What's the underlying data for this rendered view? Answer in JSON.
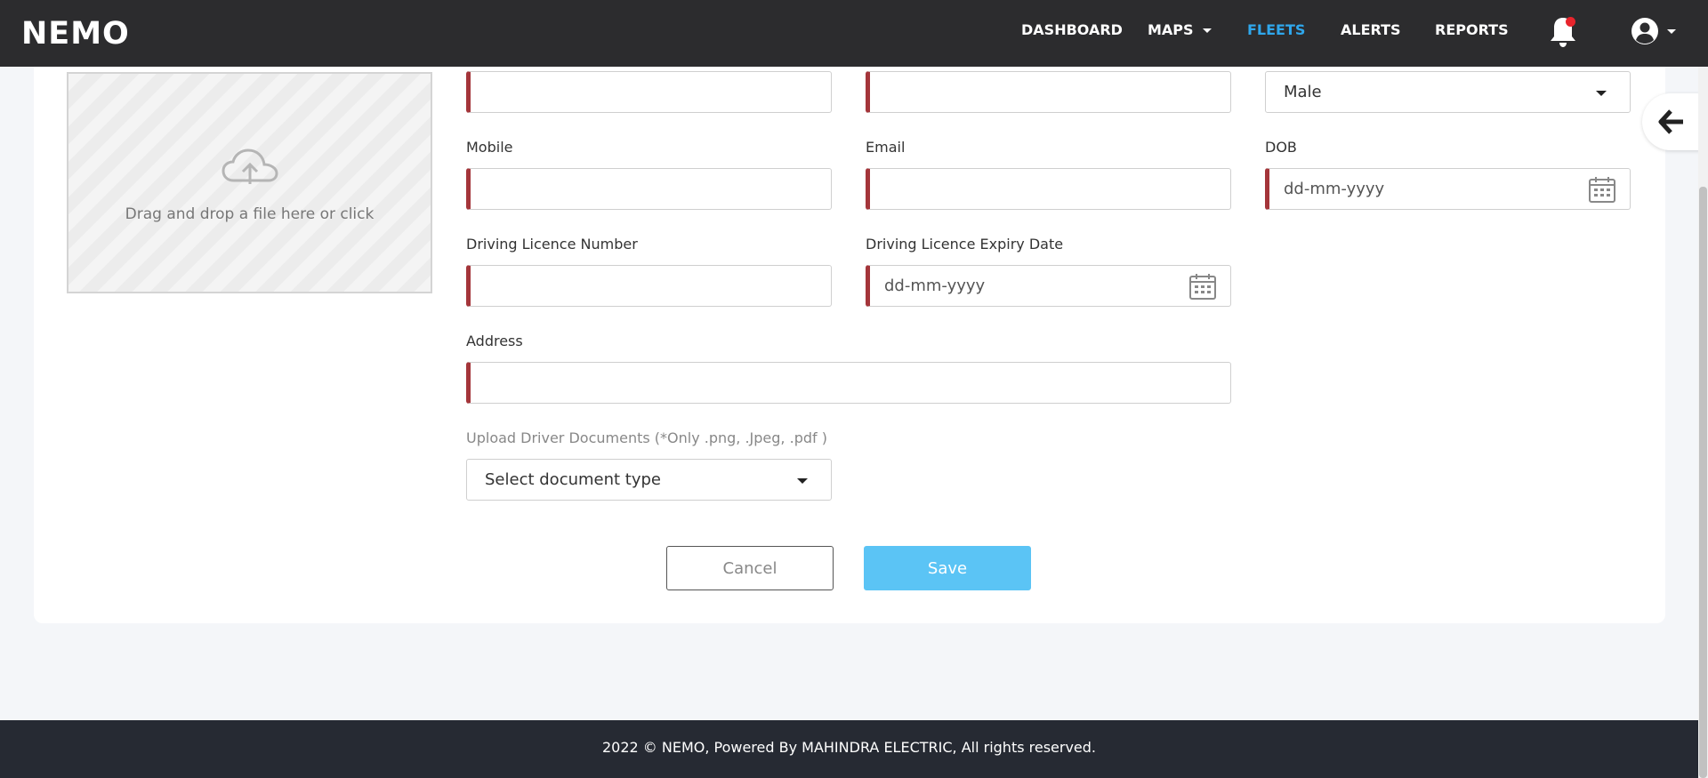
{
  "brand": {
    "logo_text": "NEMO"
  },
  "nav": {
    "items": [
      {
        "label": "DASHBOARD"
      },
      {
        "label": "MAPS"
      },
      {
        "label": "FLEETS"
      },
      {
        "label": "ALERTS"
      },
      {
        "label": "REPORTS"
      }
    ],
    "active": "FLEETS",
    "has_notification": true
  },
  "upload_area": {
    "text": "Drag and drop a file here or click"
  },
  "form": {
    "first_field": {
      "value": ""
    },
    "second_field": {
      "value": ""
    },
    "gender": {
      "selected": "Male"
    },
    "mobile": {
      "label": "Mobile",
      "value": ""
    },
    "email": {
      "label": "Email",
      "value": ""
    },
    "dob": {
      "label": "DOB",
      "placeholder": "dd-mm-yyyy"
    },
    "licence_number": {
      "label": "Driving Licence Number",
      "value": ""
    },
    "licence_expiry": {
      "label": "Driving Licence Expiry Date",
      "placeholder": "dd-mm-yyyy"
    },
    "address": {
      "label": "Address",
      "value": ""
    },
    "documents": {
      "label": "Upload Driver Documents (*Only .png, .Jpeg, .pdf )",
      "selected": "Select document type"
    }
  },
  "actions": {
    "cancel": "Cancel",
    "save": "Save"
  },
  "footer": {
    "text": "2022 © NEMO, Powered By MAHINDRA ELECTRIC, All rights reserved."
  },
  "colors": {
    "topbar": "#2c2c2e",
    "active_nav": "#2fa7ec",
    "required_bar": "#a4353a",
    "save_button": "#5bc4f5",
    "footer": "#262a33"
  }
}
